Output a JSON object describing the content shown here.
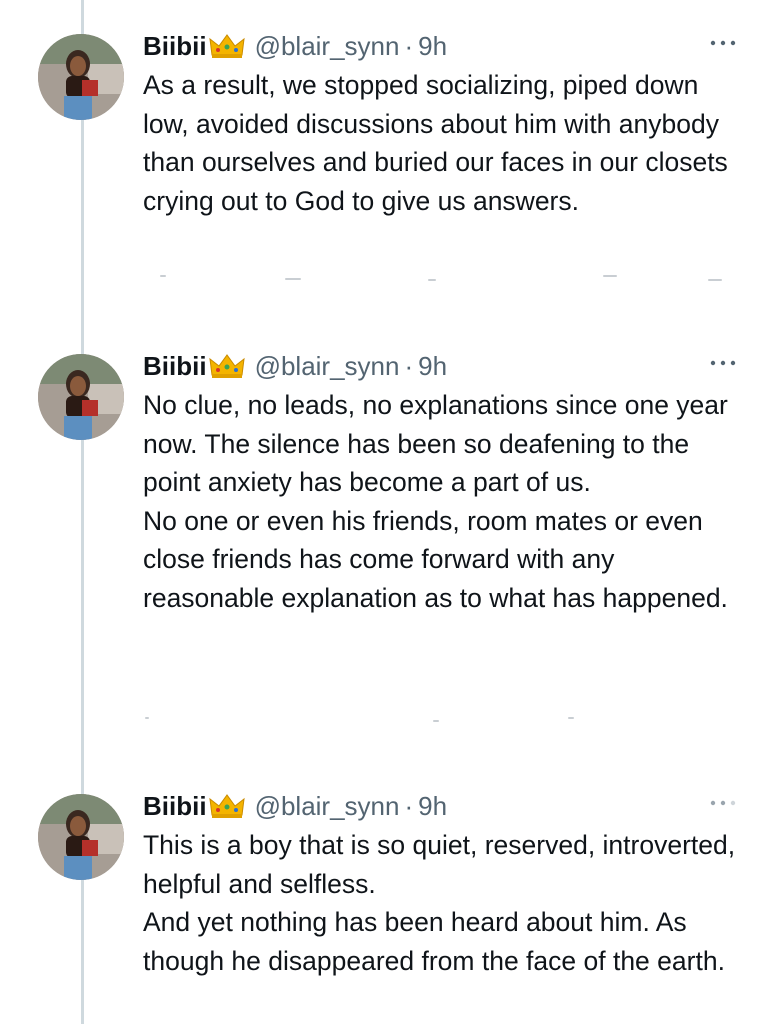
{
  "author": {
    "name": "Biibii",
    "handle": "@blair_synn",
    "separator": "·",
    "avatar_icon": "profile-photo",
    "crown_icon": "crown-emoji"
  },
  "tweets": [
    {
      "time": "9h",
      "paragraphs": [
        "As a result, we stopped socializing, piped down low, avoided discussions about him with anybody than ourselves and buried our faces in our closets crying out to God to give us answers."
      ]
    },
    {
      "time": "9h",
      "paragraphs": [
        "No clue, no leads, no explanations since one year now. The silence has been so deafening to the point anxiety has become a part of us.",
        "No one or even his friends, room mates or even close friends has come forward with any reasonable explanation as to what has happened."
      ]
    },
    {
      "time": "9h",
      "paragraphs": [
        "This is a boy that is so quiet, reserved, introverted, helpful and selfless.",
        "And yet nothing has been heard about him. As though he disappeared from the face of the earth."
      ]
    }
  ],
  "colors": {
    "text": "#0f1419",
    "secondary": "#536471",
    "thread_line": "#cfd9de",
    "crown": "#f4b400"
  }
}
